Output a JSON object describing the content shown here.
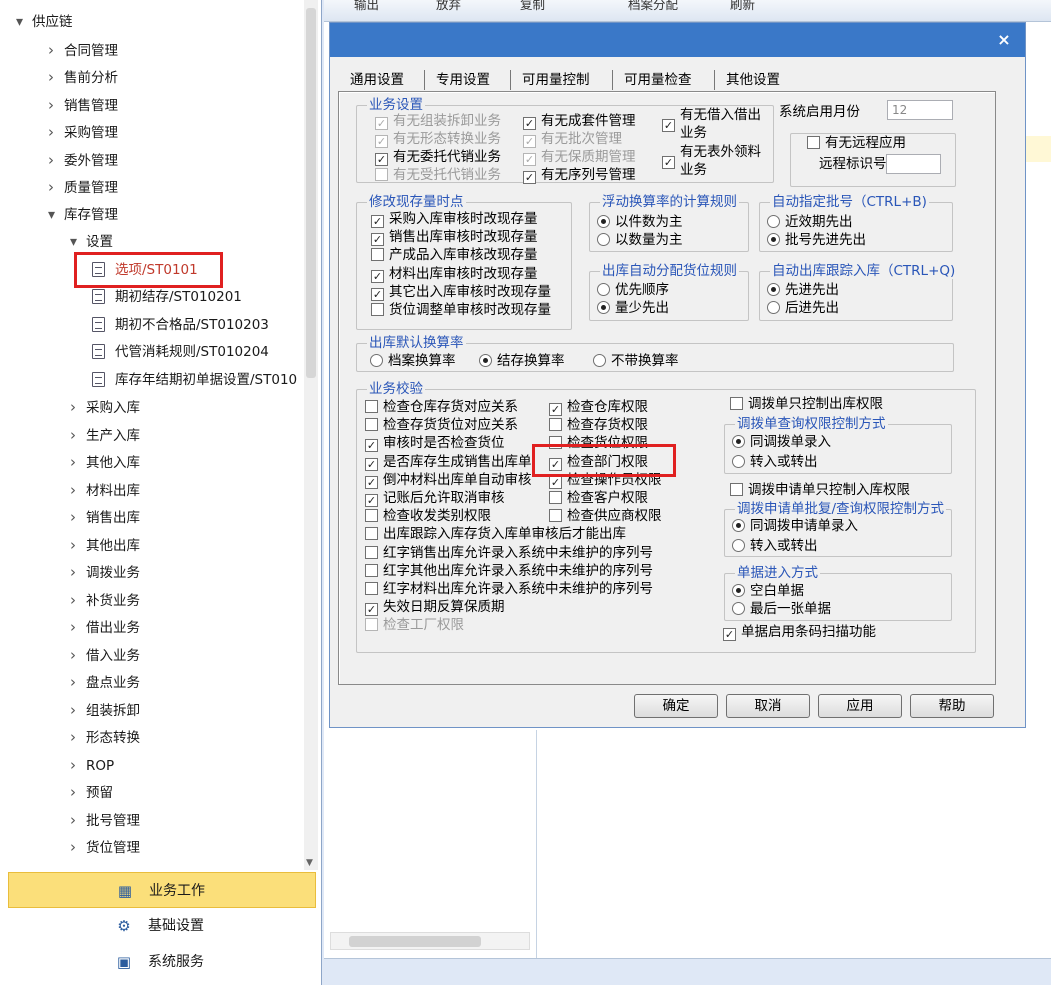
{
  "sidebar": {
    "tree": [
      {
        "label": "供应链",
        "level": 0,
        "arrow": "expanded"
      },
      {
        "label": "合同管理",
        "level": 1,
        "arrow": "collapsed"
      },
      {
        "label": "售前分析",
        "level": 1,
        "arrow": "collapsed"
      },
      {
        "label": "销售管理",
        "level": 1,
        "arrow": "collapsed"
      },
      {
        "label": "采购管理",
        "level": 1,
        "arrow": "collapsed"
      },
      {
        "label": "委外管理",
        "level": 1,
        "arrow": "collapsed"
      },
      {
        "label": "质量管理",
        "level": 1,
        "arrow": "collapsed"
      },
      {
        "label": "库存管理",
        "level": 1,
        "arrow": "expanded"
      },
      {
        "label": "设置",
        "level": 2,
        "arrow": "expanded"
      },
      {
        "label": "选项/ST0101",
        "level": 3,
        "arrow": "doc",
        "highlight": true
      },
      {
        "label": "期初结存/ST010201",
        "level": 3,
        "arrow": "doc"
      },
      {
        "label": "期初不合格品/ST010203",
        "level": 3,
        "arrow": "doc"
      },
      {
        "label": "代管消耗规则/ST010204",
        "level": 3,
        "arrow": "doc"
      },
      {
        "label": "库存年结期初单据设置/ST010",
        "level": 3,
        "arrow": "doc"
      },
      {
        "label": "采购入库",
        "level": 2,
        "arrow": "collapsed"
      },
      {
        "label": "生产入库",
        "level": 2,
        "arrow": "collapsed"
      },
      {
        "label": "其他入库",
        "level": 2,
        "arrow": "collapsed"
      },
      {
        "label": "材料出库",
        "level": 2,
        "arrow": "collapsed"
      },
      {
        "label": "销售出库",
        "level": 2,
        "arrow": "collapsed"
      },
      {
        "label": "其他出库",
        "level": 2,
        "arrow": "collapsed"
      },
      {
        "label": "调拨业务",
        "level": 2,
        "arrow": "collapsed"
      },
      {
        "label": "补货业务",
        "level": 2,
        "arrow": "collapsed"
      },
      {
        "label": "借出业务",
        "level": 2,
        "arrow": "collapsed"
      },
      {
        "label": "借入业务",
        "level": 2,
        "arrow": "collapsed"
      },
      {
        "label": "盘点业务",
        "level": 2,
        "arrow": "collapsed"
      },
      {
        "label": "组装拆卸",
        "level": 2,
        "arrow": "collapsed"
      },
      {
        "label": "形态转换",
        "level": 2,
        "arrow": "collapsed"
      },
      {
        "label": "ROP",
        "level": 2,
        "arrow": "collapsed"
      },
      {
        "label": "预留",
        "level": 2,
        "arrow": "collapsed"
      },
      {
        "label": "批号管理",
        "level": 2,
        "arrow": "collapsed"
      },
      {
        "label": "货位管理",
        "level": 2,
        "arrow": "collapsed"
      }
    ],
    "nav": [
      {
        "label": "业务工作",
        "icon": "business-work-icon",
        "glyph": "▦",
        "active": true
      },
      {
        "label": "基础设置",
        "icon": "gear-icon",
        "glyph": "⚙",
        "active": false
      },
      {
        "label": "系统服务",
        "icon": "system-service-icon",
        "glyph": "▣",
        "active": false
      }
    ]
  },
  "toolbar": {
    "items": [
      "输出",
      "放弃",
      "复制",
      "档案分配",
      "刷新"
    ]
  },
  "dialog": {
    "close": "×",
    "tabs": [
      "通用设置",
      "专用设置",
      "可用量控制",
      "可用量检查",
      "其他设置"
    ],
    "business_settings": {
      "title": "业务设置",
      "col1": [
        {
          "label": "有无组装拆卸业务",
          "checked": true,
          "disabled": true
        },
        {
          "label": "有无形态转换业务",
          "checked": true,
          "disabled": true
        },
        {
          "label": "有无委托代销业务",
          "checked": true,
          "disabled": false
        },
        {
          "label": "有无受托代销业务",
          "checked": false,
          "disabled": true
        }
      ],
      "col2": [
        {
          "label": "有无成套件管理",
          "checked": true,
          "disabled": false
        },
        {
          "label": "有无批次管理",
          "checked": true,
          "disabled": true
        },
        {
          "label": "有无保质期管理",
          "checked": true,
          "disabled": true
        },
        {
          "label": "有无序列号管理",
          "checked": true,
          "disabled": false
        }
      ],
      "col3": [
        {
          "label": "有无借入借出业务",
          "line1": "有无借入借出",
          "line2": "业务",
          "checked": true
        },
        {
          "label": "有无表外领料业务",
          "line1": "有无表外领料",
          "line2": "业务",
          "checked": true
        }
      ]
    },
    "start_month": {
      "label": "系统启用月份",
      "value": "12"
    },
    "remote": {
      "label": "有无远程应用",
      "checked": false,
      "id_label": "远程标识号",
      "id_value": ""
    },
    "modify_stock": {
      "title": "修改现存量时点",
      "items": [
        {
          "label": "采购入库审核时改现存量",
          "checked": true
        },
        {
          "label": "销售出库审核时改现存量",
          "checked": true
        },
        {
          "label": "产成品入库审核改现存量",
          "checked": false
        },
        {
          "label": "材料出库审核时改现存量",
          "checked": true
        },
        {
          "label": "其它出入库审核时改现存量",
          "checked": true
        },
        {
          "label": "货位调整单审核时改现存量",
          "checked": false
        }
      ]
    },
    "float_rate": {
      "title": "浮动换算率的计算规则",
      "options": [
        "以件数为主",
        "以数量为主"
      ],
      "selected": 0
    },
    "auto_batch": {
      "title": "自动指定批号（CTRL+B)",
      "options": [
        "近效期先出",
        "批号先进先出"
      ],
      "selected": 1
    },
    "auto_location": {
      "title": "出库自动分配货位规则",
      "options": [
        "优先顺序",
        "量少先出"
      ],
      "selected": 1
    },
    "auto_trace": {
      "title": "自动出库跟踪入库（CTRL+Q)",
      "options": [
        "先进先出",
        "后进先出"
      ],
      "selected": 0
    },
    "default_rate": {
      "title": "出库默认换算率",
      "options": [
        "档案换算率",
        "结存换算率",
        "不带换算率"
      ],
      "selected": 1
    },
    "business_check": {
      "title": "业务校验",
      "left": [
        {
          "label": "检查仓库存货对应关系",
          "checked": false,
          "disabled": false
        },
        {
          "label": "检查存货货位对应关系",
          "checked": false,
          "disabled": false
        },
        {
          "label": "审核时是否检查货位",
          "checked": true,
          "disabled": false
        },
        {
          "label": "是否库存生成销售出库单",
          "checked": true,
          "disabled": false
        },
        {
          "label": "倒冲材料出库单自动审核",
          "checked": true,
          "disabled": false
        },
        {
          "label": "记账后允许取消审核",
          "checked": true,
          "disabled": false
        },
        {
          "label": "检查收发类别权限",
          "checked": false,
          "disabled": false
        },
        {
          "label": "出库跟踪入库存货入库单审核后才能出库",
          "checked": false,
          "disabled": false
        },
        {
          "label": "红字销售出库允许录入系统中未维护的序列号",
          "checked": false,
          "disabled": false
        },
        {
          "label": "红字其他出库允许录入系统中未维护的序列号",
          "checked": false,
          "disabled": false
        },
        {
          "label": "红字材料出库允许录入系统中未维护的序列号",
          "checked": false,
          "disabled": false
        },
        {
          "label": "失效日期反算保质期",
          "checked": true,
          "disabled": false
        },
        {
          "label": "检查工厂权限",
          "checked": false,
          "disabled": true
        }
      ],
      "mid": [
        {
          "label": "检查仓库权限",
          "checked": true
        },
        {
          "label": "检查存货权限",
          "checked": false
        },
        {
          "label": "检查货位权限",
          "checked": false
        },
        {
          "label": "检查部门权限",
          "checked": true,
          "highlight": true
        },
        {
          "label": "检查操作员权限",
          "checked": true
        },
        {
          "label": "检查客户权限",
          "checked": false
        },
        {
          "label": "检查供应商权限",
          "checked": false
        }
      ],
      "transfer_out": {
        "label": "调拨单只控制出库权限",
        "checked": false
      },
      "transfer_query": {
        "title": "调拨单查询权限控制方式",
        "options": [
          "同调拨单录入",
          "转入或转出"
        ],
        "selected": 0
      },
      "transfer_in": {
        "label": "调拨申请单只控制入库权限",
        "checked": false
      },
      "transfer_apply": {
        "title": "调拨申请单批复/查询权限控制方式",
        "options": [
          "同调拨申请单录入",
          "转入或转出"
        ],
        "selected": 0
      },
      "doc_entry": {
        "title": "单据进入方式",
        "options": [
          "空白单据",
          "最后一张单据"
        ],
        "selected": 0
      },
      "barcode": {
        "label": "单据启用条码扫描功能",
        "checked": true
      }
    },
    "buttons": {
      "ok": "确定",
      "cancel": "取消",
      "apply": "应用",
      "help": "帮助"
    }
  }
}
